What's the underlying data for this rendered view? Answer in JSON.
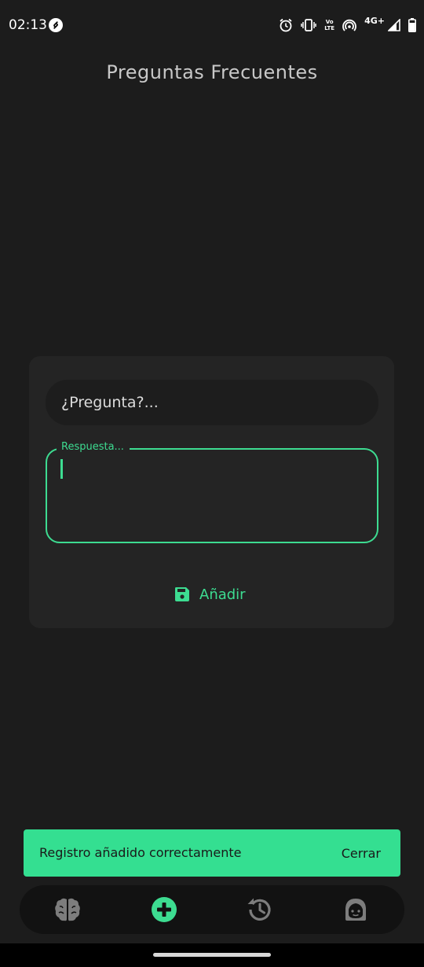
{
  "status_bar": {
    "time": "02:13",
    "network_label": "4G+",
    "volte_top": "Vo",
    "volte_bottom": "LTE",
    "icons": [
      "shazam-icon",
      "alarm-icon",
      "vibrate-icon",
      "volte-icon",
      "hotspot-icon",
      "signal-icon",
      "battery-icon"
    ]
  },
  "header": {
    "title": "Preguntas Frecuentes"
  },
  "form": {
    "question_placeholder": "¿Pregunta?...",
    "answer_label": "Respuesta...",
    "answer_value": "",
    "add_button_label": "Añadir",
    "add_button_icon": "save-icon"
  },
  "snackbar": {
    "message": "Registro añadido correctamente",
    "action_label": "Cerrar"
  },
  "bottom_nav": {
    "items": [
      {
        "icon": "brain-icon",
        "active": false
      },
      {
        "icon": "add-circle-icon",
        "active": true
      },
      {
        "icon": "history-icon",
        "active": false
      },
      {
        "icon": "user-face-icon",
        "active": false
      }
    ]
  },
  "colors": {
    "accent": "#3ddc91",
    "background": "#1c1c1c",
    "card": "#242424",
    "snackbar": "#34df91",
    "nav_bar": "#121212",
    "nav_inactive": "#7d7d7d"
  }
}
